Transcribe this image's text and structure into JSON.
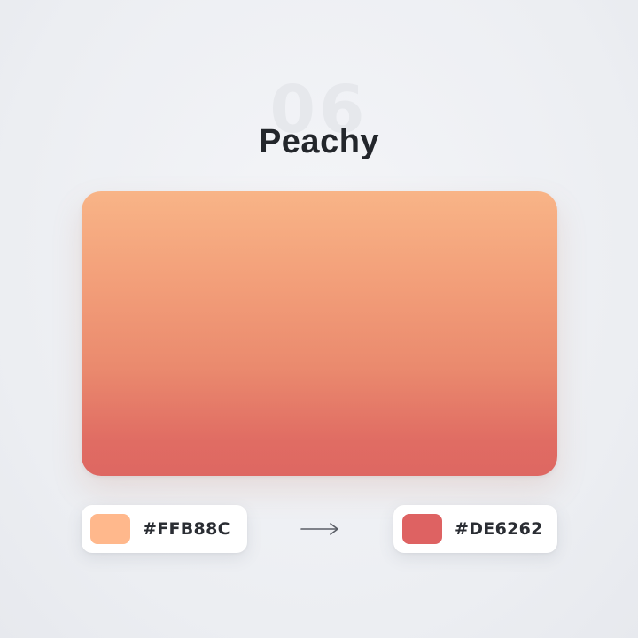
{
  "card": {
    "number": "06",
    "title": "Peachy"
  },
  "gradient": {
    "from": {
      "hex_label": "#FFB88C",
      "color": "#FFB88C"
    },
    "to": {
      "hex_label": "#DE6262",
      "color": "#DE6262"
    },
    "direction_icon": "arrow-right-icon"
  }
}
